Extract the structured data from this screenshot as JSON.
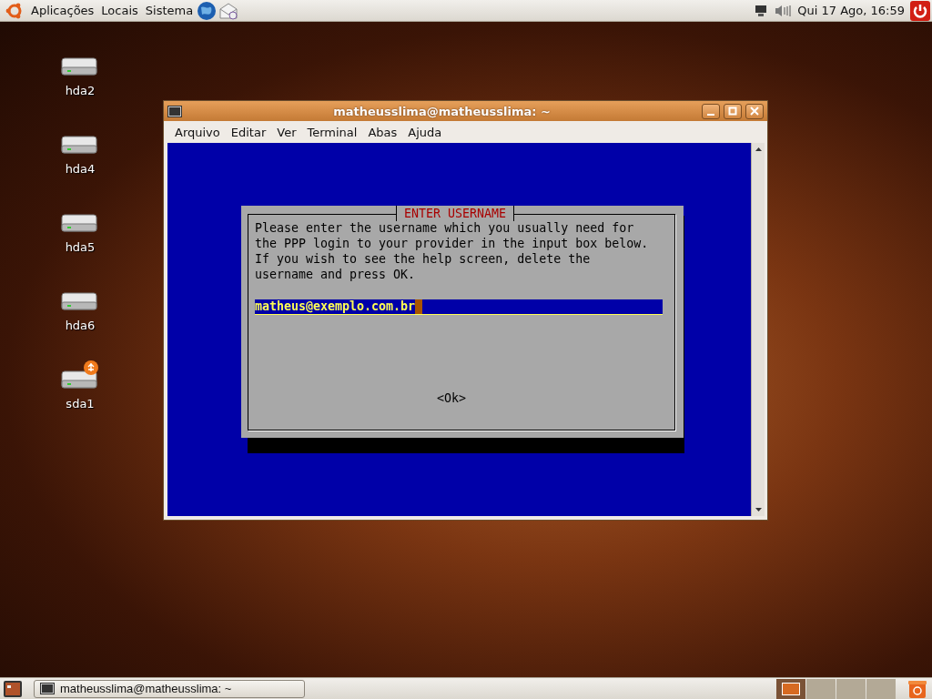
{
  "top_panel": {
    "menus": [
      "Aplicações",
      "Locais",
      "Sistema"
    ],
    "clock": "Qui 17 Ago, 16:59"
  },
  "desktop_icons": [
    {
      "label": "hda2",
      "kind": "disk"
    },
    {
      "label": "hda4",
      "kind": "disk"
    },
    {
      "label": "hda5",
      "kind": "disk"
    },
    {
      "label": "hda6",
      "kind": "disk"
    },
    {
      "label": "sda1",
      "kind": "usb"
    }
  ],
  "terminal": {
    "title": "matheusslima@matheusslima: ~",
    "menus": [
      "Arquivo",
      "Editar",
      "Ver",
      "Terminal",
      "Abas",
      "Ajuda"
    ],
    "dialog": {
      "title": "ENTER USERNAME",
      "message": "Please enter the username which you usually need for\nthe PPP login to your provider in the input box below.\nIf you wish to see the help screen, delete the\nusername and press OK.",
      "input_value": "matheus@exemplo.com.br",
      "button": "<Ok>"
    }
  },
  "taskbar": {
    "tasks": [
      "matheusslima@matheusslima: ~"
    ]
  },
  "workspaces": [
    {
      "selected": true
    },
    {
      "selected": false
    },
    {
      "selected": false
    },
    {
      "selected": false
    }
  ]
}
